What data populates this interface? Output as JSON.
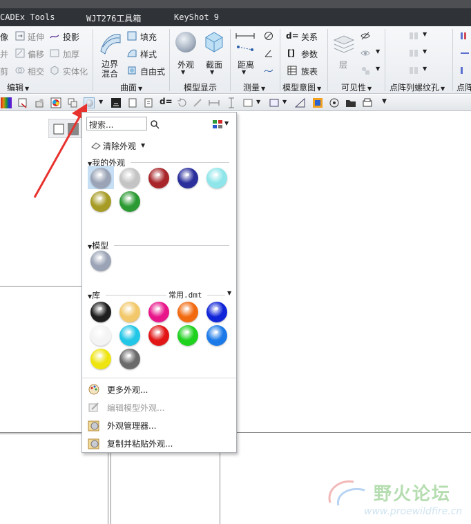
{
  "tabs": [
    {
      "label": "CADEx Tools"
    },
    {
      "label": "WJT276工具箱"
    },
    {
      "label": "KeyShot 9"
    }
  ],
  "ribbon": {
    "edit_group": {
      "rows": [
        {
          "left": "像",
          "item1": "延伸",
          "item2": "投影"
        },
        {
          "left": "并",
          "item1": "偏移",
          "item2": "加厚"
        },
        {
          "left": "剪",
          "item1": "相交",
          "item2": "实体化"
        }
      ],
      "label": "编辑"
    },
    "surface_group": {
      "big_label_line1": "边界",
      "big_label_line2": "混合",
      "items": [
        "填充",
        "样式",
        "自由式"
      ],
      "label": "曲面"
    },
    "display_group": {
      "appearance_label": "外观",
      "section_label": "截面",
      "label": "模型显示"
    },
    "measure_group": {
      "distance_label": "距离",
      "label": "测量"
    },
    "intent_group": {
      "items": [
        "关系",
        "参数",
        "族表"
      ],
      "label": "模型意图"
    },
    "visibility_group": {
      "layer_label": "层",
      "label": "可见性"
    },
    "pattern_group": {
      "label": "点阵列螺纹孔"
    },
    "cut_group": {
      "label": "点阵"
    }
  },
  "dropdown": {
    "search_placeholder": "搜索...",
    "clear_label": "清除外观",
    "my_section": "我的外观",
    "my_swatches": [
      "#9aa4b6",
      "#c4c4c4",
      "#a8262a",
      "#2a2f9c",
      "#8fe6ea",
      "#a69b25",
      "#2c9a33"
    ],
    "model_section": "模型",
    "model_swatches": [
      "#9aa4b6"
    ],
    "lib_section": "库",
    "lib_file": "常用.dmt",
    "lib_swatches": [
      "#1e1e1e",
      "#f2c86a",
      "#e8148a",
      "#f26a10",
      "#1024d8",
      "#f4f4f4",
      "#22c6e6",
      "#e21616",
      "#1ed21e",
      "#1c7ae8",
      "#eee410",
      "#6a6a6a"
    ],
    "menu": [
      {
        "label": "更多外观...",
        "enabled": true
      },
      {
        "label": "编辑模型外观...",
        "enabled": false
      },
      {
        "label": "外观管理器...",
        "enabled": true
      },
      {
        "label": "复制并粘贴外观...",
        "enabled": true
      }
    ]
  },
  "watermark": {
    "text": "野火论坛",
    "url": "www.proewildfire.cn"
  },
  "colors": {
    "arrow": "#e8322e",
    "selected_bg": "#c7dff5"
  }
}
